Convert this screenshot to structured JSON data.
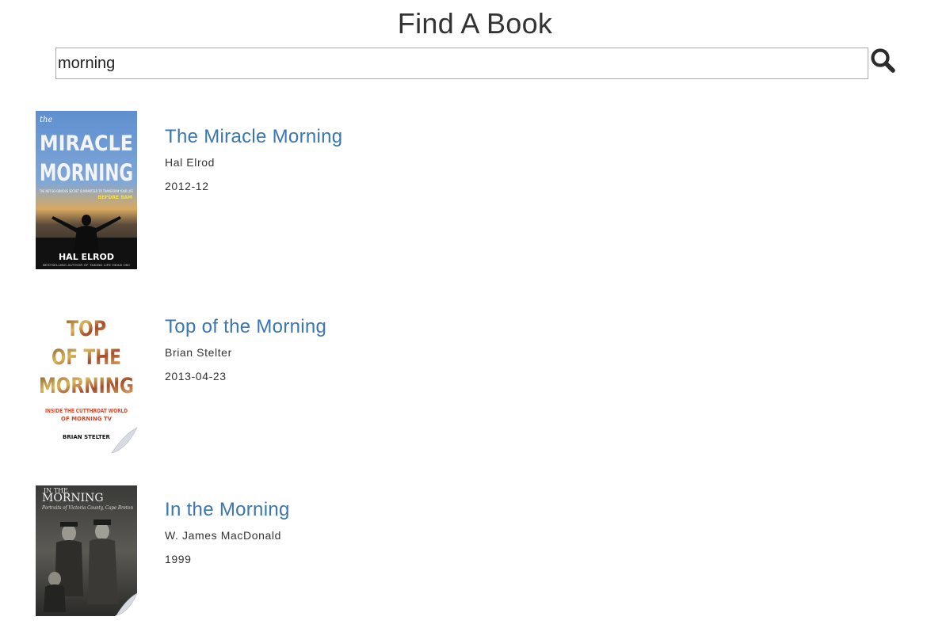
{
  "header": {
    "title": "Find A Book"
  },
  "search": {
    "value": "morning",
    "icon": "search-icon"
  },
  "results": [
    {
      "title": "The Miracle Morning",
      "author": "Hal Elrod",
      "date": "2012-12",
      "cover": {
        "top_word": "the",
        "line1": "MIRACLE",
        "line2": "MORNING",
        "tagline": "THE NOT-SO-OBVIOUS SECRET GUARANTEED TO TRANSFORM YOUR LIFE",
        "tagline2": "BEFORE 8AM",
        "author": "HAL ELROD",
        "footer": "BESTSELLING AUTHOR OF TAKING LIFE HEAD ON!"
      }
    },
    {
      "title": "Top of the Morning",
      "author": "Brian Stelter",
      "date": "2013-04-23",
      "cover": {
        "line1": "TOP",
        "line2": "OF THE",
        "line3": "MORNING",
        "sub1": "INSIDE THE CUTTHROAT WORLD",
        "sub2": "OF MORNING TV",
        "author": "BRIAN STELTER"
      }
    },
    {
      "title": "In the Morning",
      "author": "W. James MacDonald",
      "date": "1999",
      "cover": {
        "top_word": "IN THE",
        "line1": "MORNING",
        "sub": "Portraits of Victoria County, Cape Breton"
      }
    }
  ]
}
